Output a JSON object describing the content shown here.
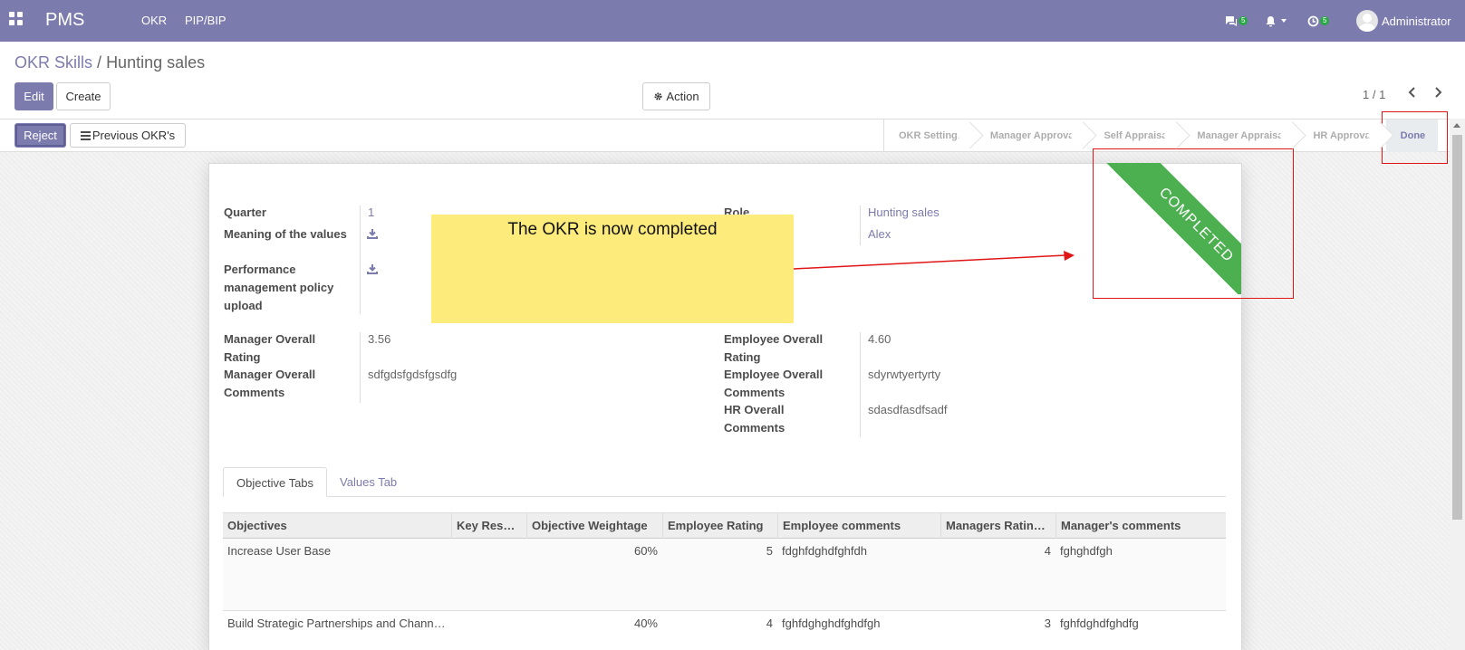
{
  "navbar": {
    "brand": "PMS",
    "menu": [
      "OKR",
      "PIP/BIP"
    ],
    "messages_count": "5",
    "activity_count": "5",
    "user": "Administrator"
  },
  "breadcrumb": {
    "parent": "OKR Skills",
    "separator": "/",
    "current": "Hunting sales"
  },
  "buttons": {
    "edit": "Edit",
    "create": "Create",
    "action": "Action",
    "reject": "Reject",
    "previous_okrs": "Previous OKR's"
  },
  "pager": "1 / 1",
  "statusbar": {
    "steps": [
      "OKR Settings",
      "Manager Approval",
      "Self Appraisal",
      "Manager Appraisal",
      "HR Approval",
      "Done"
    ],
    "current": "Done"
  },
  "form": {
    "quarter_label": "Quarter",
    "quarter_value": "1",
    "meaning_label": "Meaning of the values",
    "policy_label": "Performance management policy upload",
    "role_label": "Role",
    "role_value": "Hunting sales",
    "employee_value": "Alex",
    "manager_rating_label": "Manager Overall Rating",
    "manager_rating_value": "3.56",
    "manager_comments_label": "Manager Overall Comments",
    "manager_comments_value": "sdfgdsfgdsfgsdfg",
    "employee_rating_label": "Employee Overall Rating",
    "employee_rating_value": "4.60",
    "employee_comments_label": "Employee Overall Comments",
    "employee_comments_value": "sdyrwtyertyrty",
    "hr_comments_label": "HR Overall Comments",
    "hr_comments_value": "sdasdfasdfsadf"
  },
  "ribbon": "COMPLETED",
  "tabs": [
    "Objective Tabs",
    "Values Tab"
  ],
  "table": {
    "headers": [
      "Objectives",
      "Key Results",
      "Objective Weightage",
      "Employee Rating",
      "Employee comments",
      "Managers Ratin…",
      "Manager's comments"
    ],
    "rows": [
      [
        "Increase User Base",
        "",
        "60%",
        "5",
        "fdghfdghdfghfdh",
        "4",
        "fghghdfgh"
      ],
      [
        "Build Strategic Partnerships and Chann…",
        "",
        "40%",
        "4",
        "fghfdghghdfghdfgh",
        "3",
        "fghfdghdfghdfg"
      ]
    ]
  },
  "annotation": {
    "text": "The OKR is now completed",
    "color": "#fdec7c",
    "line_color": "#e01616"
  },
  "colors": {
    "primary": "#7c7bad",
    "ribbon": "#4caf50",
    "badge": "#28a745"
  }
}
